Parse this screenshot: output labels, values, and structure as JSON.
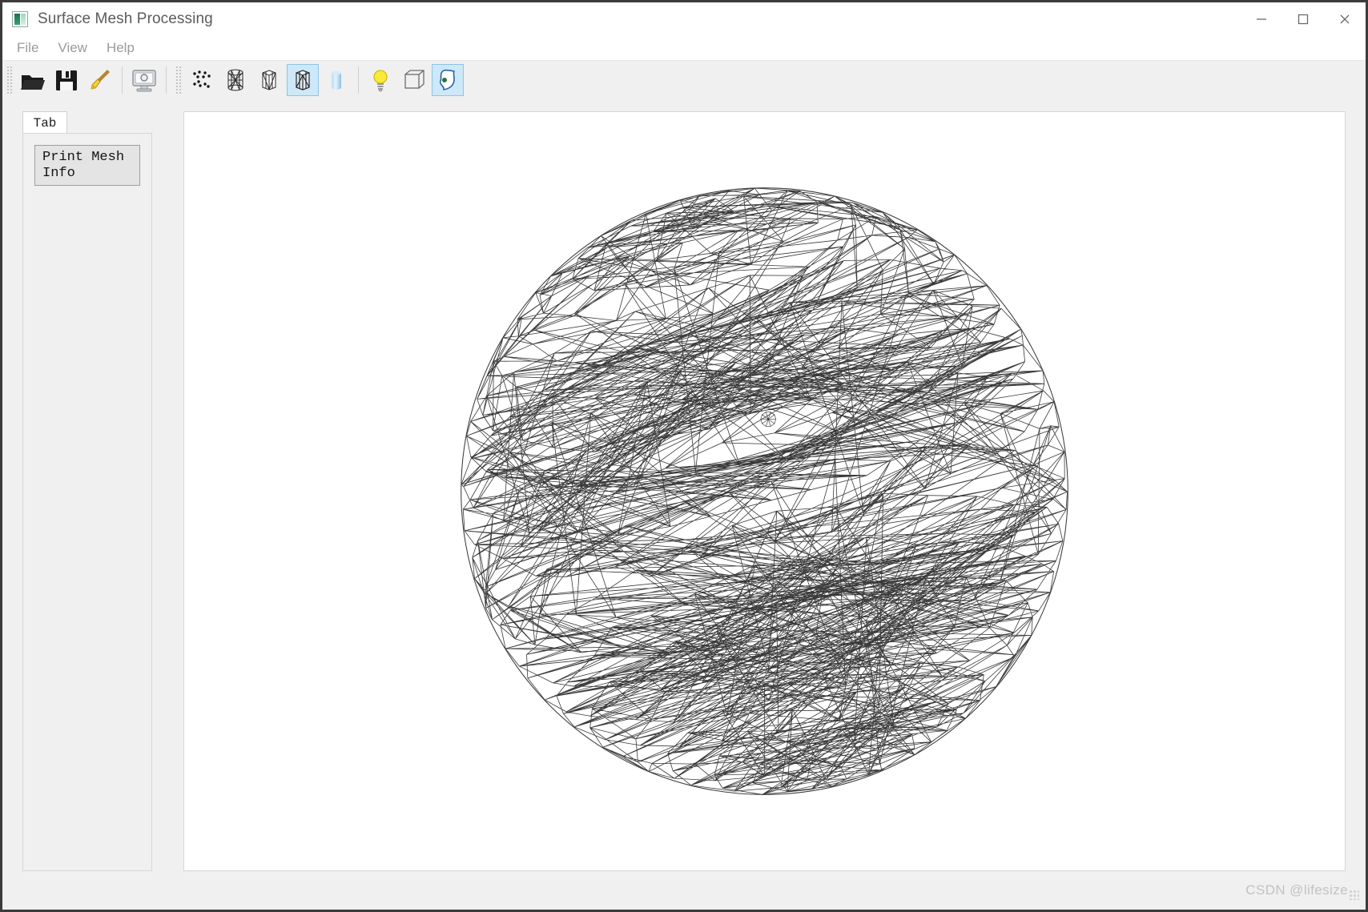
{
  "window": {
    "title": "Surface Mesh Processing",
    "app_icon": "app-image-icon",
    "controls": {
      "minimize": "minimize-icon",
      "maximize": "maximize-icon",
      "close": "close-icon"
    }
  },
  "menubar": {
    "items": [
      {
        "label": "File"
      },
      {
        "label": "View"
      },
      {
        "label": "Help"
      }
    ]
  },
  "toolbar": {
    "groups": [
      {
        "buttons": [
          {
            "icon": "open-folder-icon",
            "label": "Open",
            "active": false
          },
          {
            "icon": "save-floppy-icon",
            "label": "Save",
            "active": false
          },
          {
            "icon": "clear-broom-icon",
            "label": "Clear",
            "active": false
          }
        ]
      },
      {
        "buttons": [
          {
            "icon": "snapshot-monitor-icon",
            "label": "Snapshot",
            "active": false
          }
        ]
      },
      {
        "buttons": [
          {
            "icon": "points-cloud-icon",
            "label": "Points",
            "active": false
          },
          {
            "icon": "wireframe-icon",
            "label": "Wireframe",
            "active": false
          },
          {
            "icon": "hidden-line-icon",
            "label": "Hidden Line",
            "active": false
          },
          {
            "icon": "solid-wireframe-icon",
            "label": "Solid Wireframe",
            "active": true
          },
          {
            "icon": "solid-flat-icon",
            "label": "Solid Flat",
            "active": false
          }
        ]
      },
      {
        "buttons": [
          {
            "icon": "lighting-bulb-icon",
            "label": "Lighting",
            "active": false
          },
          {
            "icon": "bounding-box-icon",
            "label": "Bounding Box",
            "active": false
          },
          {
            "icon": "boundary-curve-icon",
            "label": "Boundary",
            "active": true
          }
        ]
      }
    ]
  },
  "sidebar": {
    "tab": {
      "label": "Tab"
    },
    "buttons": [
      {
        "label": "Print Mesh Info"
      }
    ]
  },
  "viewport": {
    "model": {
      "type": "triangular-surface-mesh",
      "silhouette": "circle",
      "render_mode": "Solid Wireframe",
      "edge_color": "#3a3a3a",
      "face_color": "#ffffff",
      "background_color": "#ffffff",
      "hub_vertices": 3,
      "center_marker": true
    }
  },
  "watermark": {
    "text": "CSDN @lifesize"
  },
  "colors": {
    "window_bg": "#f0f0f0",
    "panel_bg": "#ffffff",
    "accent_selected": "#cde8f8",
    "accent_selected_border": "#8fc4e6",
    "text": "#1c1c1c",
    "muted_text": "#9b9b9b",
    "frame_border": "#3b3b3b"
  }
}
